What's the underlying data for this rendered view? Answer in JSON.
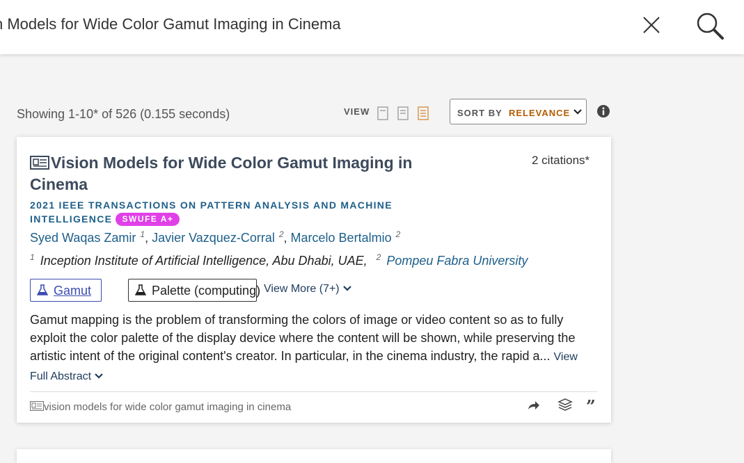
{
  "search": {
    "query": "Vision Models for Wide Color Gamut Imaging in Cinema",
    "query_visible": "n Models for Wide Color Gamut Imaging in Cinema"
  },
  "toolbar": {
    "showing": "Showing 1-10* of 526 (0.155 seconds)",
    "view_label": "VIEW",
    "view_modes": [
      "compact-view-icon",
      "default-view-icon",
      "expanded-view-icon"
    ],
    "active_view": "expanded-view-icon",
    "sort_label": "SORT BY",
    "sort_value": "RELEVANCE"
  },
  "result": {
    "title": "Vision Models for Wide Color Gamut Imaging in Cinema",
    "citations": "2 citations*",
    "venue": "2021 IEEE TRANSACTIONS ON PATTERN ANALYSIS AND MACHINE INTELLIGENCE",
    "badge": "SWUFE A+",
    "authors": [
      {
        "name": "Syed Waqas Zamir",
        "aff": "1"
      },
      {
        "name": "Javier Vazquez-Corral",
        "aff": "2"
      },
      {
        "name": "Marcelo Bertalmio",
        "aff": "2"
      }
    ],
    "affiliations": [
      {
        "num": "1",
        "name": "Inception Institute of Artificial Intelligence, Abu Dhabi, UAE,"
      },
      {
        "num": "2",
        "name": "Pompeu Fabra University"
      }
    ],
    "tags": [
      "Gamut",
      "Palette (computing)"
    ],
    "view_more": "View More (7+)",
    "abstract": "Gamut mapping is the problem of transforming the colors of image or video content so as to fully exploit the color palette of the display device where the content will be shown, while preserving the artistic intent of the original content's creator. In particular, in the cinema industry, the rapid a...",
    "view_full_abstract": "View Full Abstract",
    "footer_title": "vision models for wide color gamut imaging in cinema"
  },
  "colors": {
    "accent_link": "#1d5f8a",
    "sort_value": "#b35c00",
    "badge_bg": "#e040e8",
    "tag_primary": "#3b4bb0"
  }
}
